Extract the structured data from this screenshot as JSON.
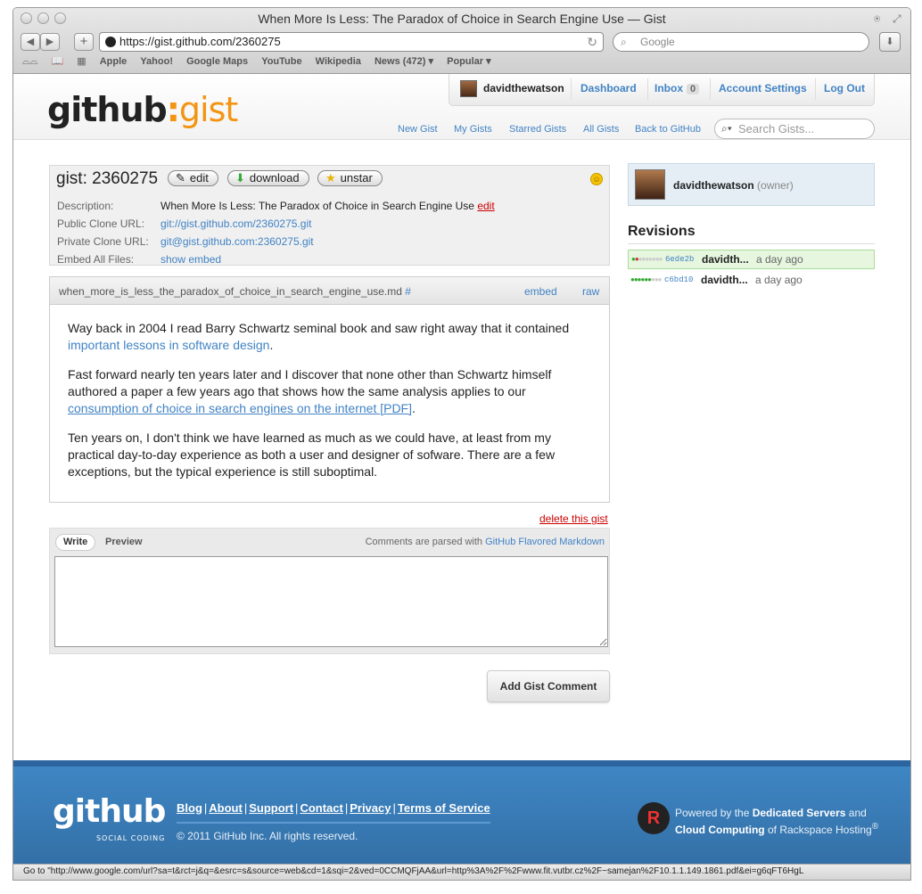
{
  "browser": {
    "window_title": "When More Is Less: The Paradox of Choice in Search Engine Use — Gist",
    "url": "https://gist.github.com/2360275",
    "search_placeholder": "Google",
    "bookmarks": [
      "Apple",
      "Yahoo!",
      "Google Maps",
      "YouTube",
      "Wikipedia",
      "News (472) ▾",
      "Popular ▾"
    ],
    "status_text": "Go to \"http://www.google.com/url?sa=t&rct=j&q=&esrc=s&source=web&cd=1&sqi=2&ved=0CCMQFjAA&url=http%3A%2F%2Fwww.fit.vutbr.cz%2F~samejan%2F10.1.1.149.1861.pdf&ei=g6qFT6HgL"
  },
  "header": {
    "logo_left": "github",
    "logo_colon": ":",
    "logo_right": "gist",
    "username": "davidthewatson",
    "dashboard": "Dashboard",
    "inbox": "Inbox",
    "inbox_count": "0",
    "account_settings": "Account Settings",
    "logout": "Log Out",
    "nav": [
      "New Gist",
      "My Gists",
      "Starred Gists",
      "All Gists",
      "Back to GitHub"
    ],
    "search_placeholder": "Search Gists..."
  },
  "gist": {
    "title": "gist: 2360275",
    "edit_label": "edit",
    "download_label": "download",
    "unstar_label": "unstar",
    "description_label": "Description:",
    "description": "When More Is Less: The Paradox of Choice in Search Engine Use",
    "description_edit": "edit",
    "public_label": "Public Clone URL:",
    "public_url": "git://gist.github.com/2360275.git",
    "private_label": "Private Clone URL:",
    "private_url": "git@gist.github.com:2360275.git",
    "embed_label": "Embed All Files:",
    "embed_link": "show embed"
  },
  "file": {
    "name": "when_more_is_less_the_paradox_of_choice_in_search_engine_use.md",
    "hash": "#",
    "embed": "embed",
    "raw": "raw",
    "p1_text": "Way back in 2004 I read Barry Schwartz seminal book and saw right away that it contained ",
    "p1_link": "important lessons in software design",
    "p1_end": ".",
    "p2_text": "Fast forward nearly ten years later and I discover that none other than Schwartz himself authored a paper a few years ago that shows how the same analysis applies to our ",
    "p2_link": "consumption of choice in search engines on the internet [PDF]",
    "p2_end": ".",
    "p3_text": "Ten years on, I don't think we have learned as much as we could have, at least from my practical day-to-day experience as both a user and designer of sofware. There are a few exceptions, but the typical experience is still suboptimal."
  },
  "delete_gist": "delete this gist",
  "comment": {
    "tab_write": "Write",
    "tab_preview": "Preview",
    "note_text": "Comments are parsed with ",
    "note_link": "GitHub Flavored Markdown",
    "value": "",
    "submit": "Add Gist Comment"
  },
  "sidebar": {
    "owner_name": "davidthewatson",
    "owner_role": "(owner)",
    "revisions_title": "Revisions",
    "revisions": [
      {
        "sha": "6ede2b",
        "author": "davidth...",
        "ago": "a day ago"
      },
      {
        "sha": "c6bd10",
        "author": "davidth...",
        "ago": "a day ago"
      }
    ]
  },
  "footer": {
    "links": [
      "Blog",
      "About",
      "Support",
      "Contact",
      "Privacy",
      "Terms of Service"
    ],
    "copyright": "© 2011 GitHub Inc. All rights reserved.",
    "logo_main": "github",
    "logo_sub": "SOCIAL CODING",
    "powered_1": "Powered by the ",
    "powered_bold_1": "Dedicated Servers",
    "powered_2": " and",
    "powered_bold_2": "Cloud Computing",
    "powered_3": " of Rackspace Hosting",
    "powered_reg": "®",
    "rackspace_logo_text": "rackspace"
  },
  "colors": {
    "link": "#4183c4",
    "gist_orange": "#f29513",
    "danger": "#cc0000",
    "footer_blue": "#3e86c4",
    "revision_selected": "#e6f6df"
  }
}
